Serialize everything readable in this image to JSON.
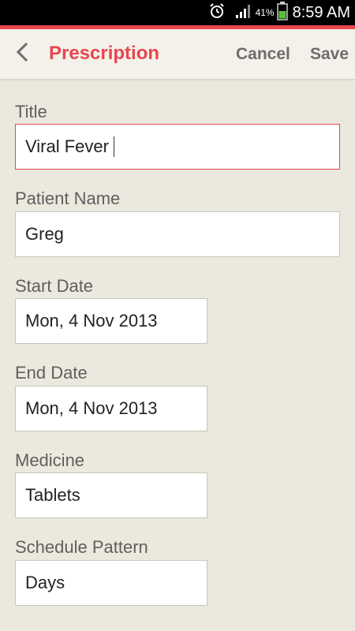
{
  "status_bar": {
    "battery_percent": "41%",
    "time": "8:59 AM",
    "icons": [
      "alarm-icon",
      "signal-icon",
      "battery-icon"
    ]
  },
  "colors": {
    "accent": "#e8464f",
    "background": "#ebe8dd",
    "action_bar": "#f3f1ea"
  },
  "action_bar": {
    "back_icon": "chevron-left-icon",
    "title": "Prescription",
    "cancel_label": "Cancel",
    "save_label": "Save"
  },
  "form": {
    "title": {
      "label": "Title",
      "value": "Viral Fever"
    },
    "patient_name": {
      "label": "Patient Name",
      "value": "Greg"
    },
    "start_date": {
      "label": "Start Date",
      "value": "Mon, 4 Nov 2013"
    },
    "end_date": {
      "label": "End Date",
      "value": "Mon, 4 Nov 2013"
    },
    "medicine": {
      "label": "Medicine",
      "value": "Tablets"
    },
    "schedule_pattern": {
      "label": "Schedule Pattern",
      "value": "Days"
    }
  }
}
